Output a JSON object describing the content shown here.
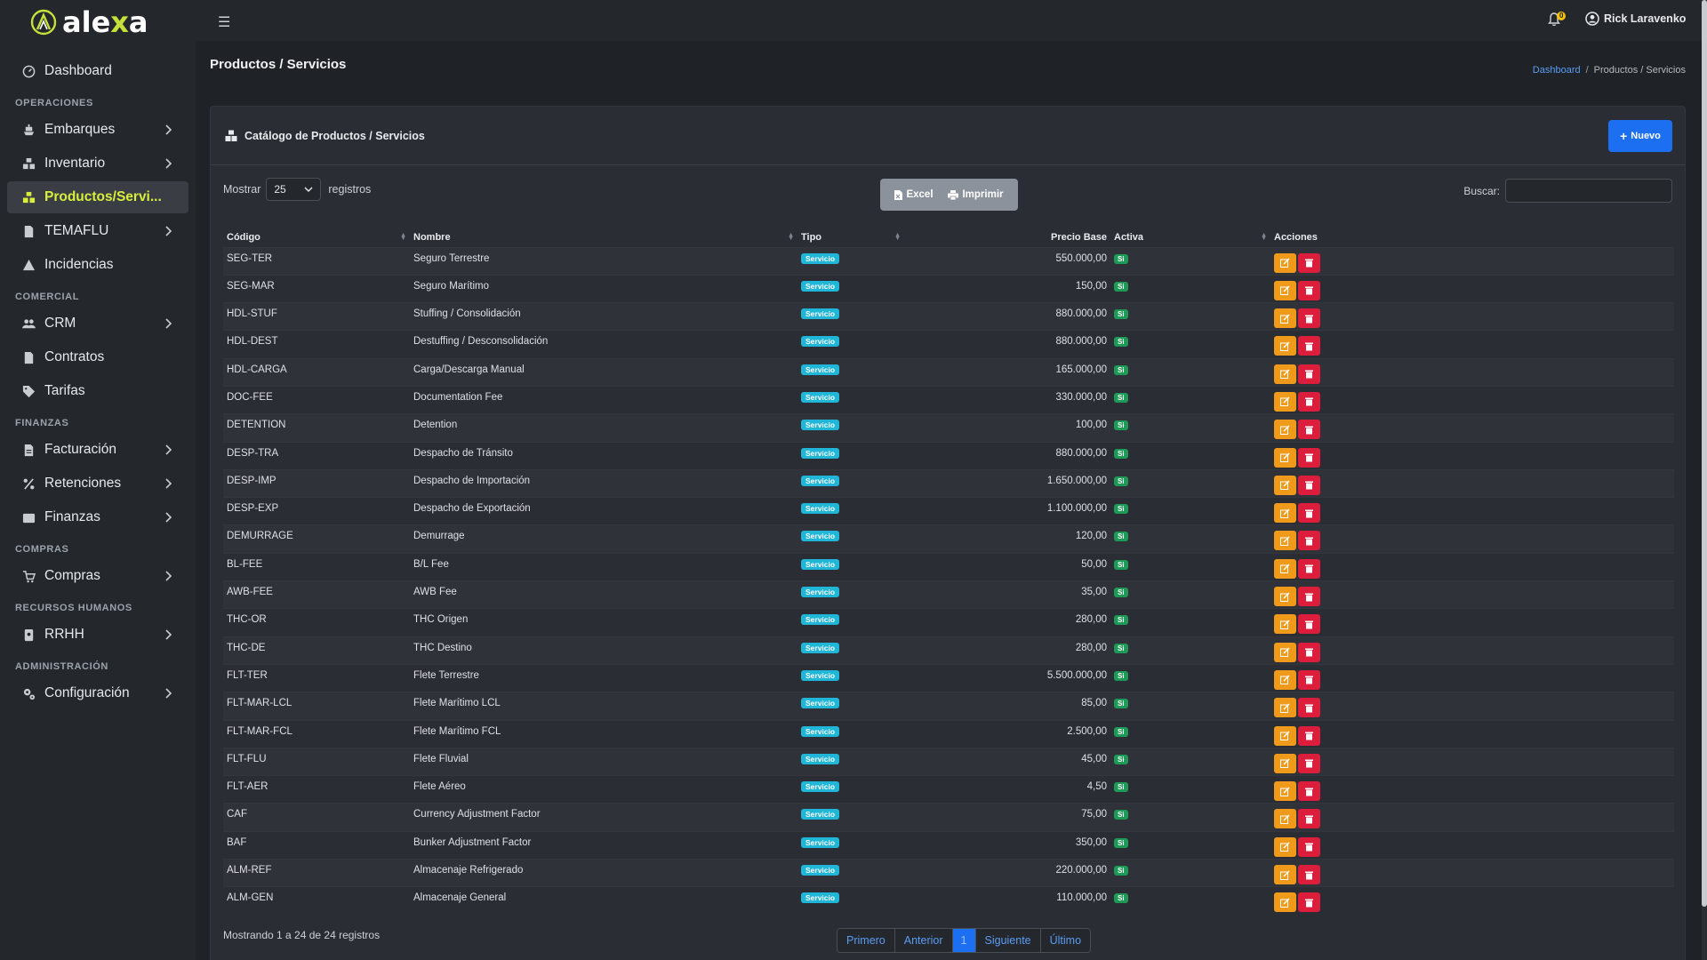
{
  "app": {
    "brand": "alexa"
  },
  "topbar": {
    "notification_count": "0",
    "user_name": "Rick Laravenko"
  },
  "sidebar": {
    "items": [
      {
        "type": "item",
        "label": "Dashboard",
        "icon": "dashboard-icon",
        "chevron": false,
        "active": false
      },
      {
        "type": "section",
        "label": "OPERACIONES"
      },
      {
        "type": "item",
        "label": "Embarques",
        "icon": "ship-icon",
        "chevron": true,
        "active": false
      },
      {
        "type": "item",
        "label": "Inventario",
        "icon": "boxes-icon",
        "chevron": true,
        "active": false
      },
      {
        "type": "item",
        "label": "Productos/Servi...",
        "icon": "boxes-icon",
        "chevron": false,
        "active": true
      },
      {
        "type": "item",
        "label": "TEMAFLU",
        "icon": "file-icon",
        "chevron": true,
        "active": false
      },
      {
        "type": "item",
        "label": "Incidencias",
        "icon": "warning-icon",
        "chevron": false,
        "active": false
      },
      {
        "type": "section",
        "label": "COMERCIAL"
      },
      {
        "type": "item",
        "label": "CRM",
        "icon": "users-icon",
        "chevron": true,
        "active": false
      },
      {
        "type": "item",
        "label": "Contratos",
        "icon": "file-icon",
        "chevron": false,
        "active": false
      },
      {
        "type": "item",
        "label": "Tarifas",
        "icon": "tags-icon",
        "chevron": false,
        "active": false
      },
      {
        "type": "section",
        "label": "FINANZAS"
      },
      {
        "type": "item",
        "label": "Facturación",
        "icon": "invoice-icon",
        "chevron": true,
        "active": false
      },
      {
        "type": "item",
        "label": "Retenciones",
        "icon": "percent-icon",
        "chevron": true,
        "active": false
      },
      {
        "type": "item",
        "label": "Finanzas",
        "icon": "wallet-icon",
        "chevron": true,
        "active": false
      },
      {
        "type": "section",
        "label": "COMPRAS"
      },
      {
        "type": "item",
        "label": "Compras",
        "icon": "cart-icon",
        "chevron": true,
        "active": false
      },
      {
        "type": "section",
        "label": "RECURSOS HUMANOS"
      },
      {
        "type": "item",
        "label": "RRHH",
        "icon": "id-badge-icon",
        "chevron": true,
        "active": false
      },
      {
        "type": "section",
        "label": "ADMINISTRACIÓN"
      },
      {
        "type": "item",
        "label": "Configuración",
        "icon": "gears-icon",
        "chevron": true,
        "active": false
      }
    ]
  },
  "page": {
    "title": "Productos / Servicios",
    "breadcrumb": {
      "home": "Dashboard",
      "separator": "/",
      "current": "Productos / Servicios"
    }
  },
  "card": {
    "title": "Catálogo de Productos / Servicios",
    "new_button": "Nuevo",
    "show_label": "Mostrar",
    "page_length": "25",
    "records_label": "registros",
    "excel_button": "Excel",
    "print_button": "Imprimir",
    "search_label": "Buscar:",
    "search_value": ""
  },
  "table": {
    "columns": [
      "Código",
      "Nombre",
      "Tipo",
      "Precio Base",
      "Activa",
      "Acciones"
    ],
    "rows": [
      {
        "codigo": "SEG-TER",
        "nombre": "Seguro Terrestre",
        "tipo": "Servicio",
        "precio": "550.000,00",
        "activa": "Si"
      },
      {
        "codigo": "SEG-MAR",
        "nombre": "Seguro Marítimo",
        "tipo": "Servicio",
        "precio": "150,00",
        "activa": "Si"
      },
      {
        "codigo": "HDL-STUF",
        "nombre": "Stuffing / Consolidación",
        "tipo": "Servicio",
        "precio": "880.000,00",
        "activa": "Si"
      },
      {
        "codigo": "HDL-DEST",
        "nombre": "Destuffing / Desconsolidación",
        "tipo": "Servicio",
        "precio": "880.000,00",
        "activa": "Si"
      },
      {
        "codigo": "HDL-CARGA",
        "nombre": "Carga/Descarga Manual",
        "tipo": "Servicio",
        "precio": "165.000,00",
        "activa": "Si"
      },
      {
        "codigo": "DOC-FEE",
        "nombre": "Documentation Fee",
        "tipo": "Servicio",
        "precio": "330.000,00",
        "activa": "Si"
      },
      {
        "codigo": "DETENTION",
        "nombre": "Detention",
        "tipo": "Servicio",
        "precio": "100,00",
        "activa": "Si"
      },
      {
        "codigo": "DESP-TRA",
        "nombre": "Despacho de Tránsito",
        "tipo": "Servicio",
        "precio": "880.000,00",
        "activa": "Si"
      },
      {
        "codigo": "DESP-IMP",
        "nombre": "Despacho de Importación",
        "tipo": "Servicio",
        "precio": "1.650.000,00",
        "activa": "Si"
      },
      {
        "codigo": "DESP-EXP",
        "nombre": "Despacho de Exportación",
        "tipo": "Servicio",
        "precio": "1.100.000,00",
        "activa": "Si"
      },
      {
        "codigo": "DEMURRAGE",
        "nombre": "Demurrage",
        "tipo": "Servicio",
        "precio": "120,00",
        "activa": "Si"
      },
      {
        "codigo": "BL-FEE",
        "nombre": "B/L Fee",
        "tipo": "Servicio",
        "precio": "50,00",
        "activa": "Si"
      },
      {
        "codigo": "AWB-FEE",
        "nombre": "AWB Fee",
        "tipo": "Servicio",
        "precio": "35,00",
        "activa": "Si"
      },
      {
        "codigo": "THC-OR",
        "nombre": "THC Origen",
        "tipo": "Servicio",
        "precio": "280,00",
        "activa": "Si"
      },
      {
        "codigo": "THC-DE",
        "nombre": "THC Destino",
        "tipo": "Servicio",
        "precio": "280,00",
        "activa": "Si"
      },
      {
        "codigo": "FLT-TER",
        "nombre": "Flete Terrestre",
        "tipo": "Servicio",
        "precio": "5.500.000,00",
        "activa": "Si"
      },
      {
        "codigo": "FLT-MAR-LCL",
        "nombre": "Flete Marítimo LCL",
        "tipo": "Servicio",
        "precio": "85,00",
        "activa": "Si"
      },
      {
        "codigo": "FLT-MAR-FCL",
        "nombre": "Flete Marítimo FCL",
        "tipo": "Servicio",
        "precio": "2.500,00",
        "activa": "Si"
      },
      {
        "codigo": "FLT-FLU",
        "nombre": "Flete Fluvial",
        "tipo": "Servicio",
        "precio": "45,00",
        "activa": "Si"
      },
      {
        "codigo": "FLT-AER",
        "nombre": "Flete Aéreo",
        "tipo": "Servicio",
        "precio": "4,50",
        "activa": "Si"
      },
      {
        "codigo": "CAF",
        "nombre": "Currency Adjustment Factor",
        "tipo": "Servicio",
        "precio": "75,00",
        "activa": "Si"
      },
      {
        "codigo": "BAF",
        "nombre": "Bunker Adjustment Factor",
        "tipo": "Servicio",
        "precio": "350,00",
        "activa": "Si"
      },
      {
        "codigo": "ALM-REF",
        "nombre": "Almacenaje Refrigerado",
        "tipo": "Servicio",
        "precio": "220.000,00",
        "activa": "Si"
      },
      {
        "codigo": "ALM-GEN",
        "nombre": "Almacenaje General",
        "tipo": "Servicio",
        "precio": "110.000,00",
        "activa": "Si"
      }
    ]
  },
  "footer": {
    "info": "Mostrando 1 a 24 de 24 registros",
    "pager": {
      "first": "Primero",
      "prev": "Anterior",
      "current": "1",
      "next": "Siguiente",
      "last": "Último"
    }
  },
  "colors": {
    "accent": "#1d6ff2",
    "active_nav": "#d8ee3c",
    "edit": "#f09a1c",
    "delete": "#dc1d3b",
    "badge_servicio": "#1fb6d8",
    "badge_si": "#1e9a57"
  }
}
